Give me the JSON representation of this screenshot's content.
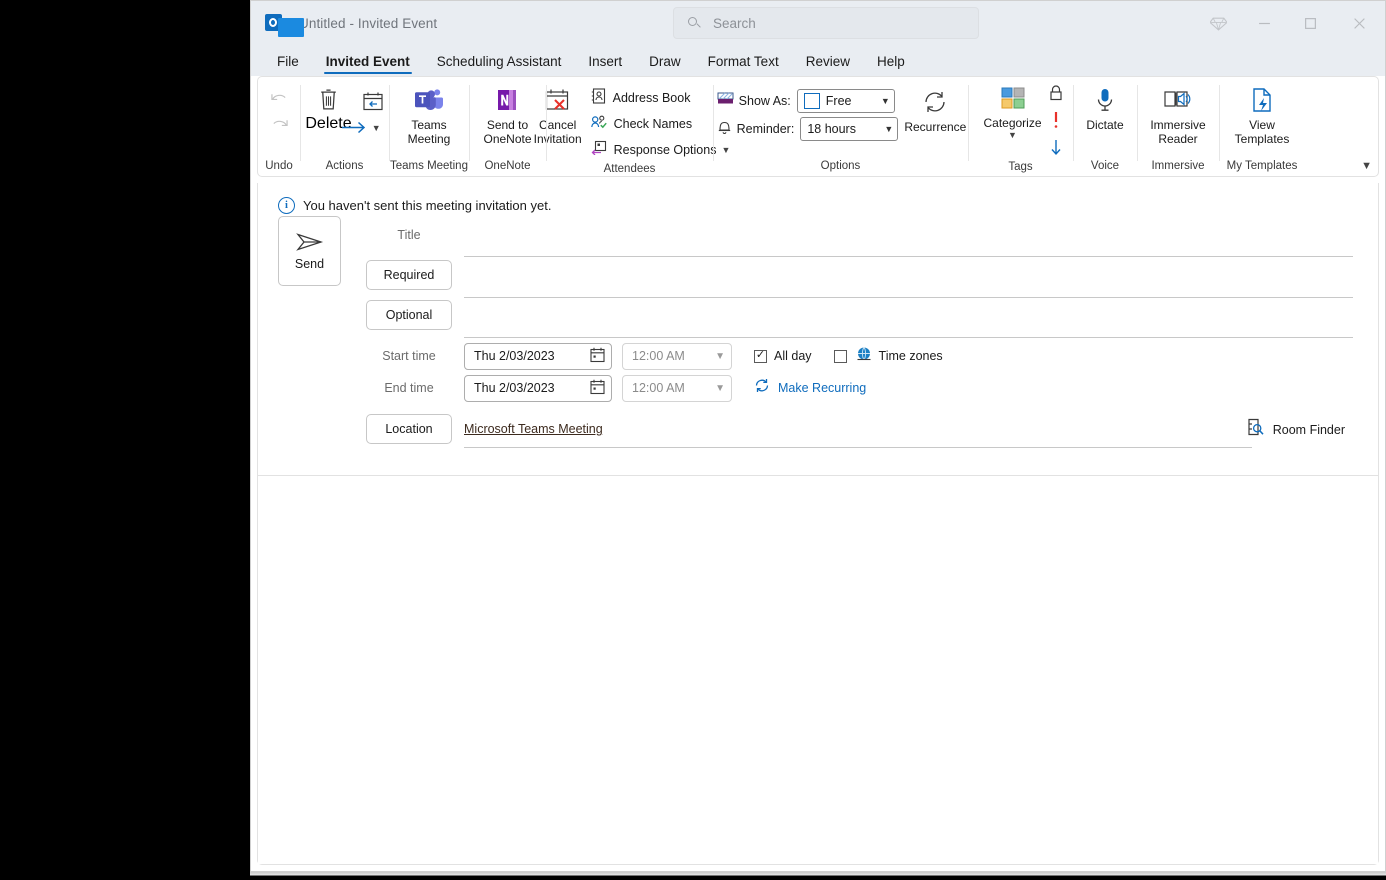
{
  "window": {
    "title_doc": "Untitled",
    "title_sep": "-",
    "title_kind": "Invited Event",
    "search_placeholder": "Search",
    "controls": {
      "diamond": "diamond-icon",
      "minimize": "—",
      "maximize": "□",
      "close": "✕"
    }
  },
  "tabs": [
    {
      "label": "File",
      "active": false
    },
    {
      "label": "Invited Event",
      "active": true
    },
    {
      "label": "Scheduling Assistant",
      "active": false
    },
    {
      "label": "Insert",
      "active": false
    },
    {
      "label": "Draw",
      "active": false
    },
    {
      "label": "Format Text",
      "active": false
    },
    {
      "label": "Review",
      "active": false
    },
    {
      "label": "Help",
      "active": false
    }
  ],
  "ribbon": {
    "groups": {
      "undo": {
        "label": "Undo",
        "undo": "Undo",
        "redo": "Redo"
      },
      "actions": {
        "label": "Actions",
        "delete": "Delete",
        "meeting_notes": "Meeting Notes",
        "forward": "Forward",
        "more": "More"
      },
      "teams": {
        "label": "Teams Meeting",
        "button": "Teams\nMeeting",
        "line1": "Teams",
        "line2": "Meeting"
      },
      "onenote": {
        "label": "OneNote",
        "line1": "Send to",
        "line2": "OneNote"
      },
      "attendees": {
        "label": "Attendees",
        "cancel_line1": "Cancel",
        "cancel_line2": "Invitation",
        "address_book": "Address Book",
        "check_names": "Check Names",
        "response_options": "Response Options"
      },
      "options": {
        "label": "Options",
        "show_as_label": "Show As:",
        "show_as_value": "Free",
        "reminder_label": "Reminder:",
        "reminder_value": "18 hours",
        "recurrence": "Recurrence"
      },
      "tags": {
        "label": "Tags",
        "categorize": "Categorize",
        "private": "Private",
        "high_importance": "High Importance",
        "low_importance": "Low Importance"
      },
      "voice": {
        "label": "Voice",
        "dictate": "Dictate"
      },
      "immersive": {
        "label": "Immersive",
        "line1": "Immersive",
        "line2": "Reader"
      },
      "templates": {
        "label": "My Templates",
        "line1": "View",
        "line2": "Templates"
      }
    },
    "collapse": "collapse-ribbon"
  },
  "form": {
    "info_message": "You haven't sent this meeting invitation yet.",
    "send_label": "Send",
    "title_label": "Title",
    "title_value": "",
    "required_label": "Required",
    "required_value": "",
    "optional_label": "Optional",
    "optional_value": "",
    "start_time_label": "Start time",
    "start_date": "Thu 2/03/2023",
    "start_time": "12:00 AM",
    "end_time_label": "End time",
    "end_date": "Thu 2/03/2023",
    "end_time": "12:00 AM",
    "all_day_label": "All day",
    "all_day_checked": true,
    "time_zones_label": "Time zones",
    "time_zones_checked": false,
    "make_recurring_label": "Make Recurring",
    "location_label": "Location",
    "location_value": "Microsoft Teams Meeting",
    "room_finder_label": "Room Finder",
    "body_value": ""
  },
  "colors": {
    "accent": "#0f6cbd",
    "titlebar": "#e9edf2",
    "window_bg": "#ffffff",
    "desktop": "#000000",
    "teams_purple": "#5b5fc7",
    "onenote_purple": "#7719aa",
    "cancel_red": "#d83b01",
    "cat_blue": "#4a9ade",
    "cat_gray": "#a6a6a6",
    "cat_orange": "#f2b23e",
    "cat_green": "#76c47c"
  }
}
